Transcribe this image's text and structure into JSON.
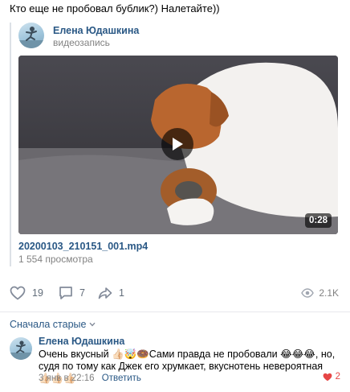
{
  "post": {
    "text": "Кто еще не пробовал бублик?) Налетайте))"
  },
  "repost": {
    "author_name": "Елена Юдашкина",
    "author_subtitle": "видеозапись",
    "video": {
      "duration": "0:28",
      "title": "20200103_210151_001.mp4",
      "views": "1 554 просмотра"
    }
  },
  "actions": {
    "likes": "19",
    "comments": "7",
    "shares": "1",
    "views": "2.1K"
  },
  "comments": {
    "sort_label": "Сначала старые",
    "items": [
      {
        "author": "Елена Юдашкина",
        "text": "Очень вкусный 👍🏻🤯🍩Сами правда не пробовали 😂😂😂, но, судя по тому как Джек его хрумкает, вкуснотень невероятная 👍🏻👍🏻👍🏻",
        "date": "3 янв в 22:16",
        "reply_label": "Ответить",
        "likes": "2"
      }
    ]
  },
  "colors": {
    "link": "#2a5885",
    "secondary": "#828282",
    "like_active": "#e64646"
  }
}
